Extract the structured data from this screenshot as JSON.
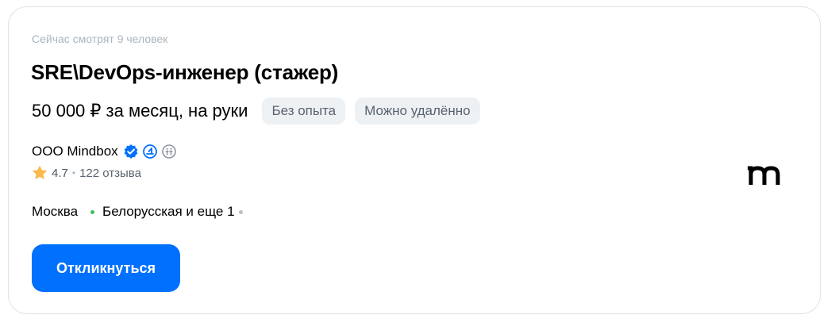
{
  "vacancy": {
    "viewers_text": "Сейчас смотрят 9 человек",
    "title": "SRE\\DevOps-инженер (стажер)",
    "salary": "50 000 ₽ за месяц, на руки",
    "tags": [
      "Без опыта",
      "Можно удалённо"
    ]
  },
  "company": {
    "name": "ООО Mindbox",
    "badges": [
      "verified-icon",
      "it-accreditation-icon",
      "employer-info-icon"
    ],
    "rating": "4.7",
    "reviews": "122 отзыва",
    "logo": "mindbox-logo"
  },
  "location": {
    "city": "Москва",
    "metro": "Белорусская и еще 1"
  },
  "actions": {
    "apply_label": "Откликнуться"
  },
  "colors": {
    "primary": "#0070ff",
    "verified": "#0070ff",
    "star": "#fab94a",
    "metro": "#3dbe5a",
    "tag_bg": "#eef1f4"
  }
}
